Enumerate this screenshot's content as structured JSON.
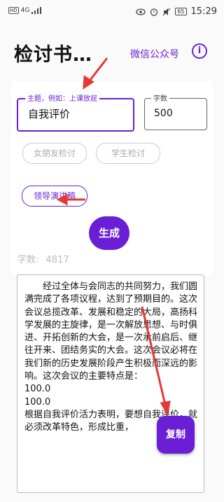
{
  "status_bar": {
    "network": "4G",
    "battery": "65",
    "time": "15:29"
  },
  "header": {
    "title": "检讨书…",
    "wechat_link": "微信公众号",
    "info_icon": "i"
  },
  "form": {
    "topic_label": "主题，例如：上课放屁",
    "topic_value": "自我评价",
    "count_label": "字数",
    "count_value": "500"
  },
  "chips": [
    {
      "label": "女朋友检讨",
      "selected": false
    },
    {
      "label": "学生检讨",
      "selected": false
    },
    {
      "label": "领导演讲稿",
      "selected": true
    }
  ],
  "generate_label": "生成",
  "word_count": {
    "label": "字数:",
    "value": "4817"
  },
  "output_text": "经过全体与会同志的共同努力，我们圆满完成了各项议程，达到了预期目的。这次会议总揽改革、发展和稳定的大局，高扬科学发展的主旋律，是一次解放思想、与时俱进、开拓创新的大会，是一次承前启后、继往开来、团结务实的大会。这次会议必将在我们新的历史发展阶段产生积极而深远的影响。这次会议的主要特点是：\n100.0\n100.0\n根据自我评价活力表明，要想自我评价，就必须改革特色，形成比重，",
  "copy_label": "复制",
  "colors": {
    "accent": "#6a1fd6",
    "annotation": "#e53935"
  }
}
